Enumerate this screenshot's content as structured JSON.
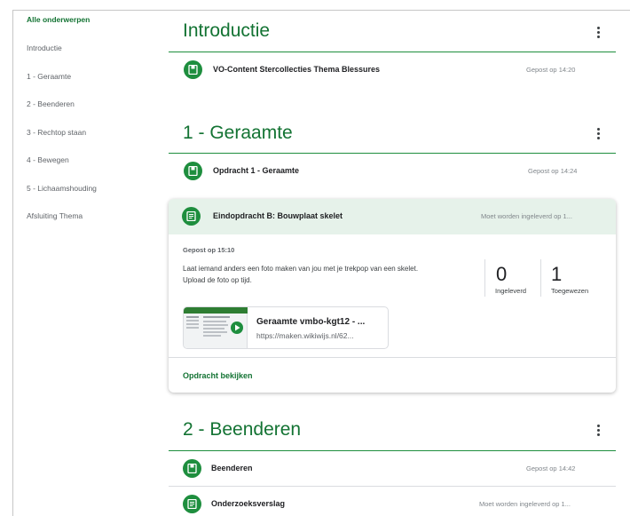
{
  "sidebar": {
    "items": [
      {
        "label": "Alle onderwerpen"
      },
      {
        "label": "Introductie"
      },
      {
        "label": "1 - Geraamte"
      },
      {
        "label": "2 - Beenderen"
      },
      {
        "label": "3 - Rechtop staan"
      },
      {
        "label": "4 - Bewegen"
      },
      {
        "label": "5 - Lichaamshouding"
      },
      {
        "label": "Afsluiting Thema"
      }
    ]
  },
  "topics": [
    {
      "title": "Introductie",
      "items": [
        {
          "title": "VO-Content Stercollecties Thema Blessures",
          "meta": "Gepost op 14:20",
          "icon": "material-icon"
        }
      ]
    },
    {
      "title": "1 - Geraamte",
      "items": [
        {
          "title": "Opdracht 1 - Geraamte",
          "meta": "Gepost op 14:24",
          "icon": "material-icon"
        }
      ],
      "assignment": {
        "title": "Eindopdracht B: Bouwplaat skelet",
        "meta": "Moet worden ingeleverd op 1...",
        "icon": "assignment-icon",
        "posted": "Gepost op 15:10",
        "description_line1": "Laat iemand anders een foto maken van jou met je trekpop van een skelet.",
        "description_line2": "Upload de foto op tijd.",
        "stats": [
          {
            "value": "0",
            "label": "Ingeleverd"
          },
          {
            "value": "1",
            "label": "Toegewezen"
          }
        ],
        "attachment": {
          "title": "Geraamte vmbo-kgt12 - ...",
          "url": "https://maken.wikiwijs.nl/62..."
        },
        "link": "Opdracht bekijken"
      }
    },
    {
      "title": "2 - Beenderen",
      "items": [
        {
          "title": "Beenderen",
          "meta": "Gepost op 14:42",
          "icon": "material-icon"
        },
        {
          "title": "Onderzoeksverslag",
          "meta": "Moet worden ingeleverd op 1...",
          "icon": "assignment-icon"
        }
      ]
    }
  ],
  "colors": {
    "accent": "#137333",
    "icon_green": "#1e8e3e",
    "card_header": "#e6f2ea"
  }
}
